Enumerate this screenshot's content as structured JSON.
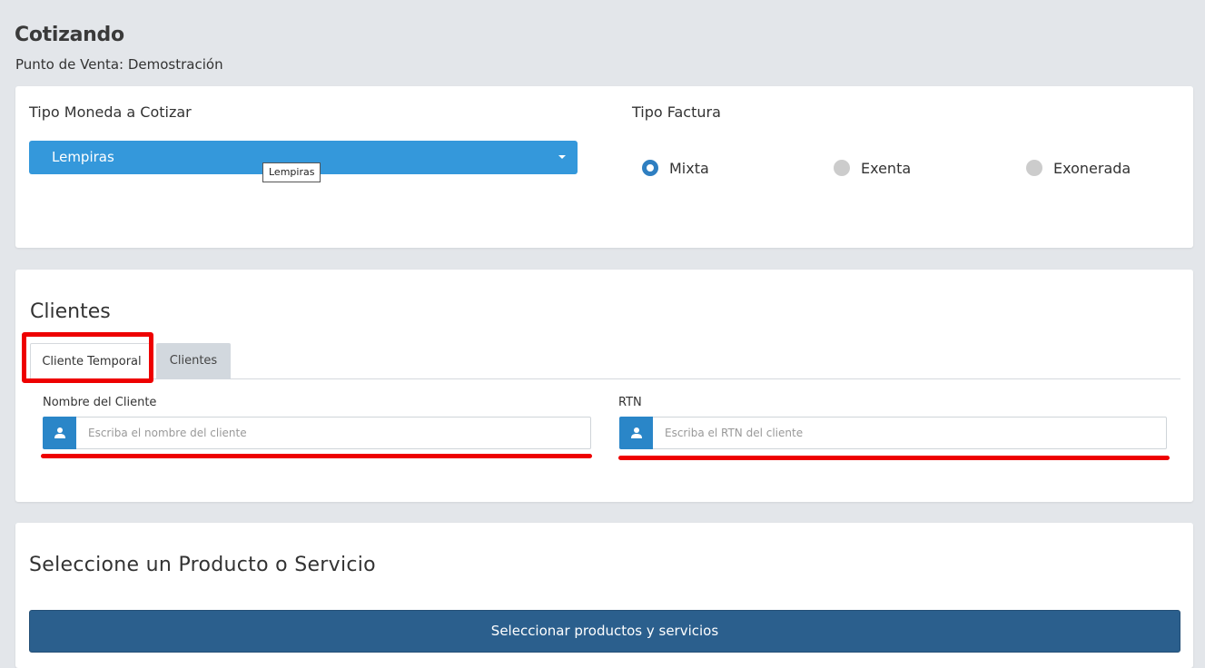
{
  "header": {
    "title": "Cotizando",
    "subtitle": "Punto de Venta: Demostración"
  },
  "currency": {
    "label": "Tipo Moneda a Cotizar",
    "selected": "Lempiras",
    "tooltip": "Lempiras"
  },
  "invoice_type": {
    "label": "Tipo Factura",
    "options": [
      {
        "label": "Mixta",
        "checked": true
      },
      {
        "label": "Exenta",
        "checked": false
      },
      {
        "label": "Exonerada",
        "checked": false
      }
    ]
  },
  "clients": {
    "title": "Clientes",
    "tabs": [
      {
        "label": "Cliente Temporal",
        "active": true
      },
      {
        "label": "Clientes",
        "active": false
      }
    ],
    "name_field": {
      "label": "Nombre del Cliente",
      "placeholder": "Escriba el nombre del cliente",
      "value": ""
    },
    "rtn_field": {
      "label": "RTN",
      "placeholder": "Escriba el RTN del cliente",
      "value": ""
    }
  },
  "products": {
    "title": "Seleccione un Producto o Servicio",
    "button_label": "Seleccionar productos y servicios"
  },
  "icons": {
    "user": "user-icon",
    "caret": "caret-down-icon"
  },
  "colors": {
    "primary": "#3498db",
    "addon": "#2a86c8",
    "button": "#2b5f8d",
    "annotation": "#ee0000",
    "radio_checked": "#2f7fc1"
  }
}
